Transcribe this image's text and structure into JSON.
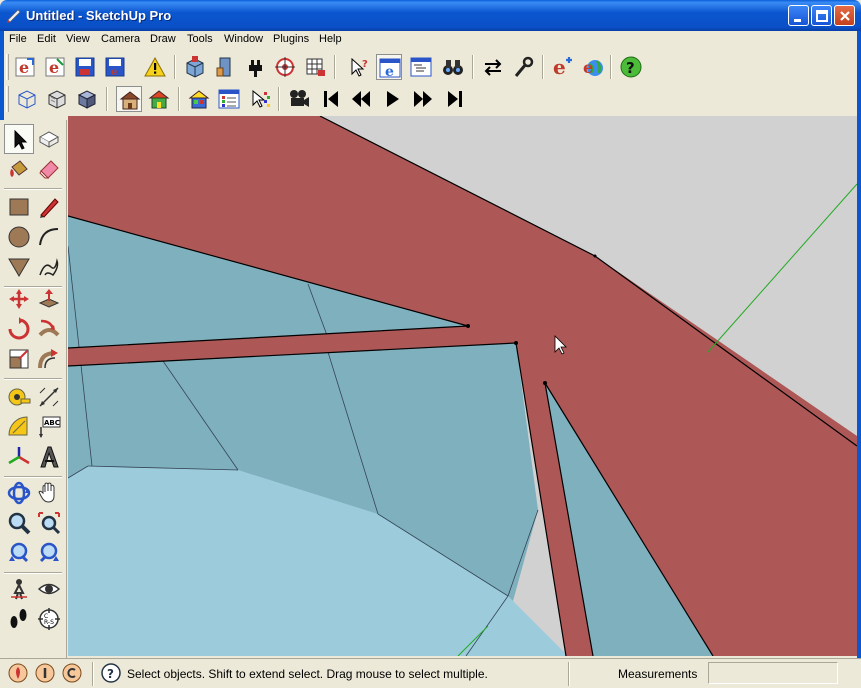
{
  "window": {
    "title": "Untitled - SketchUp Pro",
    "buttons": [
      "minimize-icon",
      "maximize-icon",
      "close-icon"
    ]
  },
  "menu": {
    "items": [
      "File",
      "Edit",
      "View",
      "Camera",
      "Draw",
      "Tools",
      "Window",
      "Plugins",
      "Help"
    ]
  },
  "toolbar_top": {
    "icons": [
      "ie-export-icon",
      "ie-import-icon",
      "save-icon",
      "save-as-icon",
      "warning-icon",
      "component-icon",
      "component-plugin-icon",
      "plug-icon",
      "target-dc-icon",
      "grid-dc-icon",
      "select-help-icon",
      "ie-window-icon",
      "outliner-icon",
      "binoculars-icon",
      "arrows-swap-icon",
      "wrench-icon",
      "ie-add-icon",
      "ie-globe-icon",
      "help-icon"
    ]
  },
  "toolbar_second": {
    "icons": [
      "wireframe-cube-icon",
      "hidden-line-cube-icon",
      "shaded-cube-icon",
      "house-icon",
      "house-colored-icon",
      "house-textured-icon",
      "materials-window-icon",
      "pointer-color-icon",
      "movie-camera-icon",
      "first-frame-icon",
      "rewind-icon",
      "play-icon",
      "fast-forward-icon",
      "last-frame-icon"
    ]
  },
  "left_tools": {
    "icons": [
      "select-arrow-icon",
      "eraser-box-icon",
      "paint-bucket-icon",
      "eraser-icon",
      "rectangle-icon",
      "pencil-icon",
      "circle-icon",
      "arc-icon",
      "polygon-icon",
      "freehand-icon",
      "move-icon",
      "push-pull-icon",
      "rotate-icon",
      "follow-me-icon",
      "scale-icon",
      "offset-icon",
      "tape-measure-icon",
      "dimension-icon",
      "protractor-icon",
      "text-icon",
      "axes-icon",
      "3d-text-icon",
      "orbit-icon",
      "pan-hand-icon",
      "zoom-icon",
      "zoom-window-icon",
      "previous-view-icon",
      "next-view-icon",
      "position-camera-icon",
      "look-around-icon",
      "walk-icon",
      "section-plane-icon"
    ]
  },
  "statusbar": {
    "text": "Select objects. Shift to extend select. Drag mouse to select multiple.",
    "measurements_label": "Measurements",
    "measurements_value": ""
  },
  "colors": {
    "red_face": "#ad5757",
    "blue_face": "#7fb0be",
    "light_blue": "#9cccdc",
    "background": "#d1d1d1",
    "axis_green": "#22aa22"
  }
}
